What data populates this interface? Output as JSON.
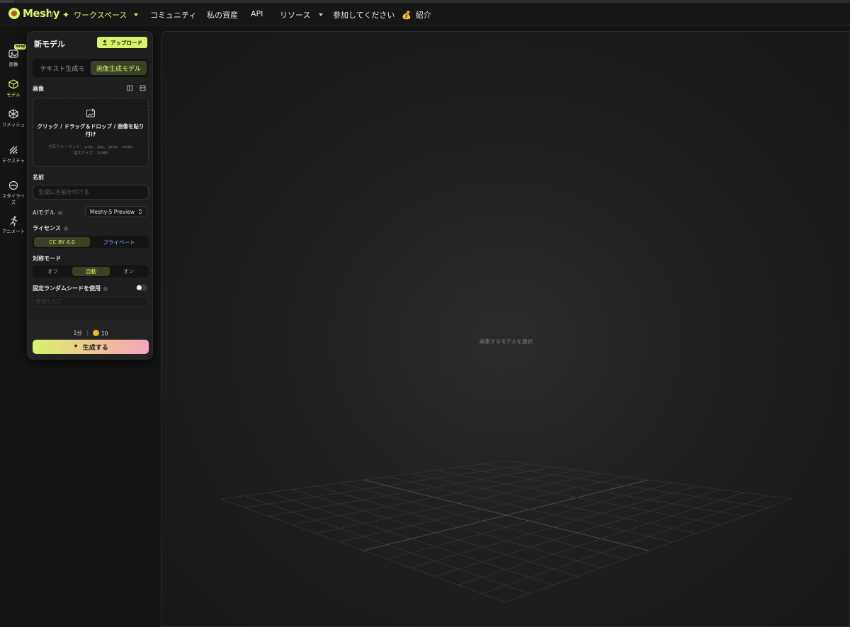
{
  "nav": {
    "brand": "Meshy",
    "workspace": "ワークスペース",
    "items": [
      "コミュニティ",
      "私の資産",
      "API",
      "リソース",
      "参加してください",
      "紹介"
    ],
    "referral_icon": "💰"
  },
  "rail": {
    "items": [
      {
        "label": "画像",
        "icon": "image-icon",
        "badge": "NEW"
      },
      {
        "label": "モデル",
        "icon": "cube-icon"
      },
      {
        "label": "リメッシュ",
        "icon": "remesh-icon"
      },
      {
        "label": "テクスチャ",
        "icon": "texture-icon"
      },
      {
        "label": "スタイライズ",
        "icon": "stylize-icon"
      },
      {
        "label": "アニメート",
        "icon": "running-icon"
      }
    ]
  },
  "panel": {
    "title": "新モデル",
    "upload_label": "アップロード",
    "tabs": [
      "テキスト生成モ",
      "画像生成モデル"
    ],
    "image_section": "画像",
    "dropzone": {
      "main": "クリック / ドラッグ＆ドロップ / 画像を貼り付け",
      "formats": "対応フォーマット：.png、.jpg、.jpeg、.webp",
      "max_size": "最大サイズ：20MB"
    },
    "name_label": "名前",
    "name_placeholder": "生成に名前を付ける",
    "ai_model_label": "AIモデル",
    "ai_model_value": "Meshy-5 Preview",
    "license_label": "ライセンス",
    "license_options": [
      "CC BY 4.0",
      "プライベート"
    ],
    "symmetry_label": "対称モード",
    "symmetry_options": [
      "オフ",
      "自動",
      "オン"
    ],
    "seed_label": "固定ランダムシードを使用",
    "seed_placeholder": "数値を入力",
    "time": "1分",
    "credits": "10",
    "generate_label": "生成する"
  },
  "viewport": {
    "hint": "編集するモデルを選択"
  }
}
